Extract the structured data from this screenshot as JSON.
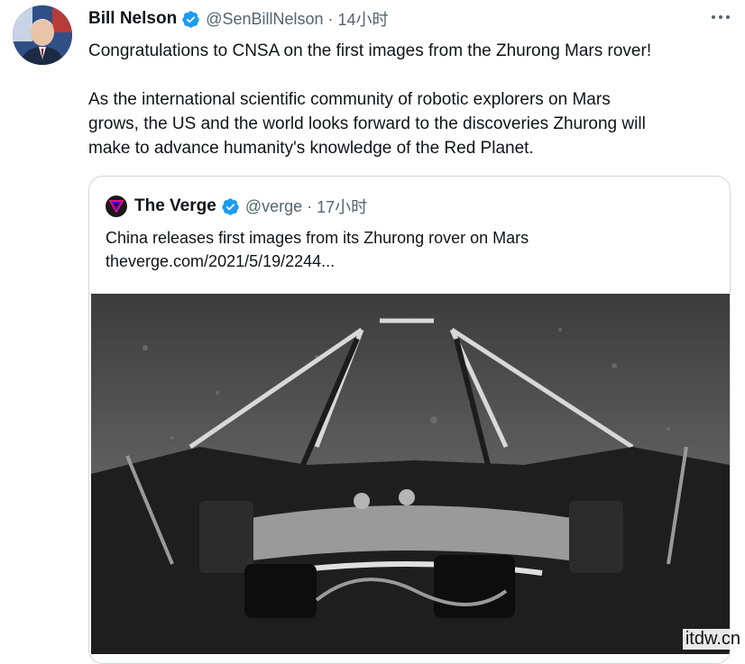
{
  "tweet": {
    "author_name": "Bill Nelson",
    "handle": "@SenBillNelson",
    "separator": "·",
    "time": "14小时",
    "text_line1": "Congratulations to CNSA on the first images from the Zhurong Mars rover!",
    "text_para2_line1": "As the international scientific community of robotic explorers on Mars",
    "text_para2_line2": "grows, the US and the world looks forward to the discoveries Zhurong will",
    "text_para2_line3": "make to advance humanity's knowledge of the Red Planet.",
    "more_icon": "more-icon",
    "verified_icon": "verified-badge-icon"
  },
  "quoted": {
    "author_name": "The Verge",
    "handle": "@verge",
    "separator": "·",
    "time": "17小时",
    "text": "China releases first images from its Zhurong rover on Mars",
    "link": "theverge.com/2021/5/19/2244...",
    "logo_icon": "verge-logo-icon"
  },
  "watermark": "itdw.cn",
  "colors": {
    "verified": "#1d9bf0",
    "secondary_text": "#536471",
    "border": "#cfd9de"
  }
}
